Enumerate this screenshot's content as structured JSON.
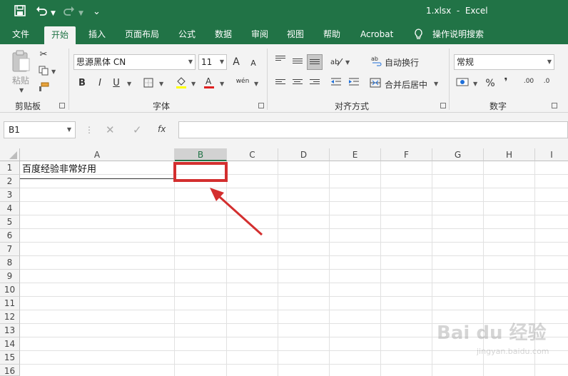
{
  "window": {
    "title": "1.xlsx  -  Excel"
  },
  "quick_access": {
    "save_icon": "save-icon",
    "undo_icon": "undo-icon",
    "redo_icon": "redo-icon",
    "more": "⌄"
  },
  "menu": {
    "tabs": [
      "文件",
      "开始",
      "插入",
      "页面布局",
      "公式",
      "数据",
      "审阅",
      "视图",
      "帮助",
      "Acrobat"
    ],
    "active": "开始",
    "tell_me": "操作说明搜索"
  },
  "ribbon": {
    "clipboard": {
      "paste": "粘贴",
      "label": "剪贴板"
    },
    "font": {
      "name": "思源黑体 CN",
      "size": "11",
      "bold": "B",
      "italic": "I",
      "underline": "U",
      "grow": "A",
      "shrink": "A",
      "phonetic": "wén",
      "label": "字体"
    },
    "alignment": {
      "wrap": "自动换行",
      "merge": "合并后居中",
      "label": "对齐方式"
    },
    "number": {
      "format": "常规",
      "percent": "%",
      "comma": "❜",
      "inc_decimal": ".00",
      "dec_decimal": ".0",
      "label": "数字"
    }
  },
  "formula_bar": {
    "name_box": "B1",
    "fx": "fx",
    "value": ""
  },
  "grid": {
    "columns": [
      "A",
      "B",
      "C",
      "D",
      "E",
      "F",
      "G",
      "H",
      "I"
    ],
    "selected_column": "B",
    "rows": [
      "1",
      "2",
      "3",
      "4",
      "5",
      "6",
      "7",
      "8",
      "9",
      "10",
      "11",
      "12",
      "13",
      "14",
      "15",
      "16"
    ],
    "cells": {
      "A1": "百度经验非常好用"
    },
    "selected_cell": "B1"
  },
  "watermark": {
    "line1": "Bai du 经验",
    "line2": "jingyan.baidu.com"
  },
  "colors": {
    "excel_green": "#217346",
    "highlight_red": "#d32f2f"
  }
}
